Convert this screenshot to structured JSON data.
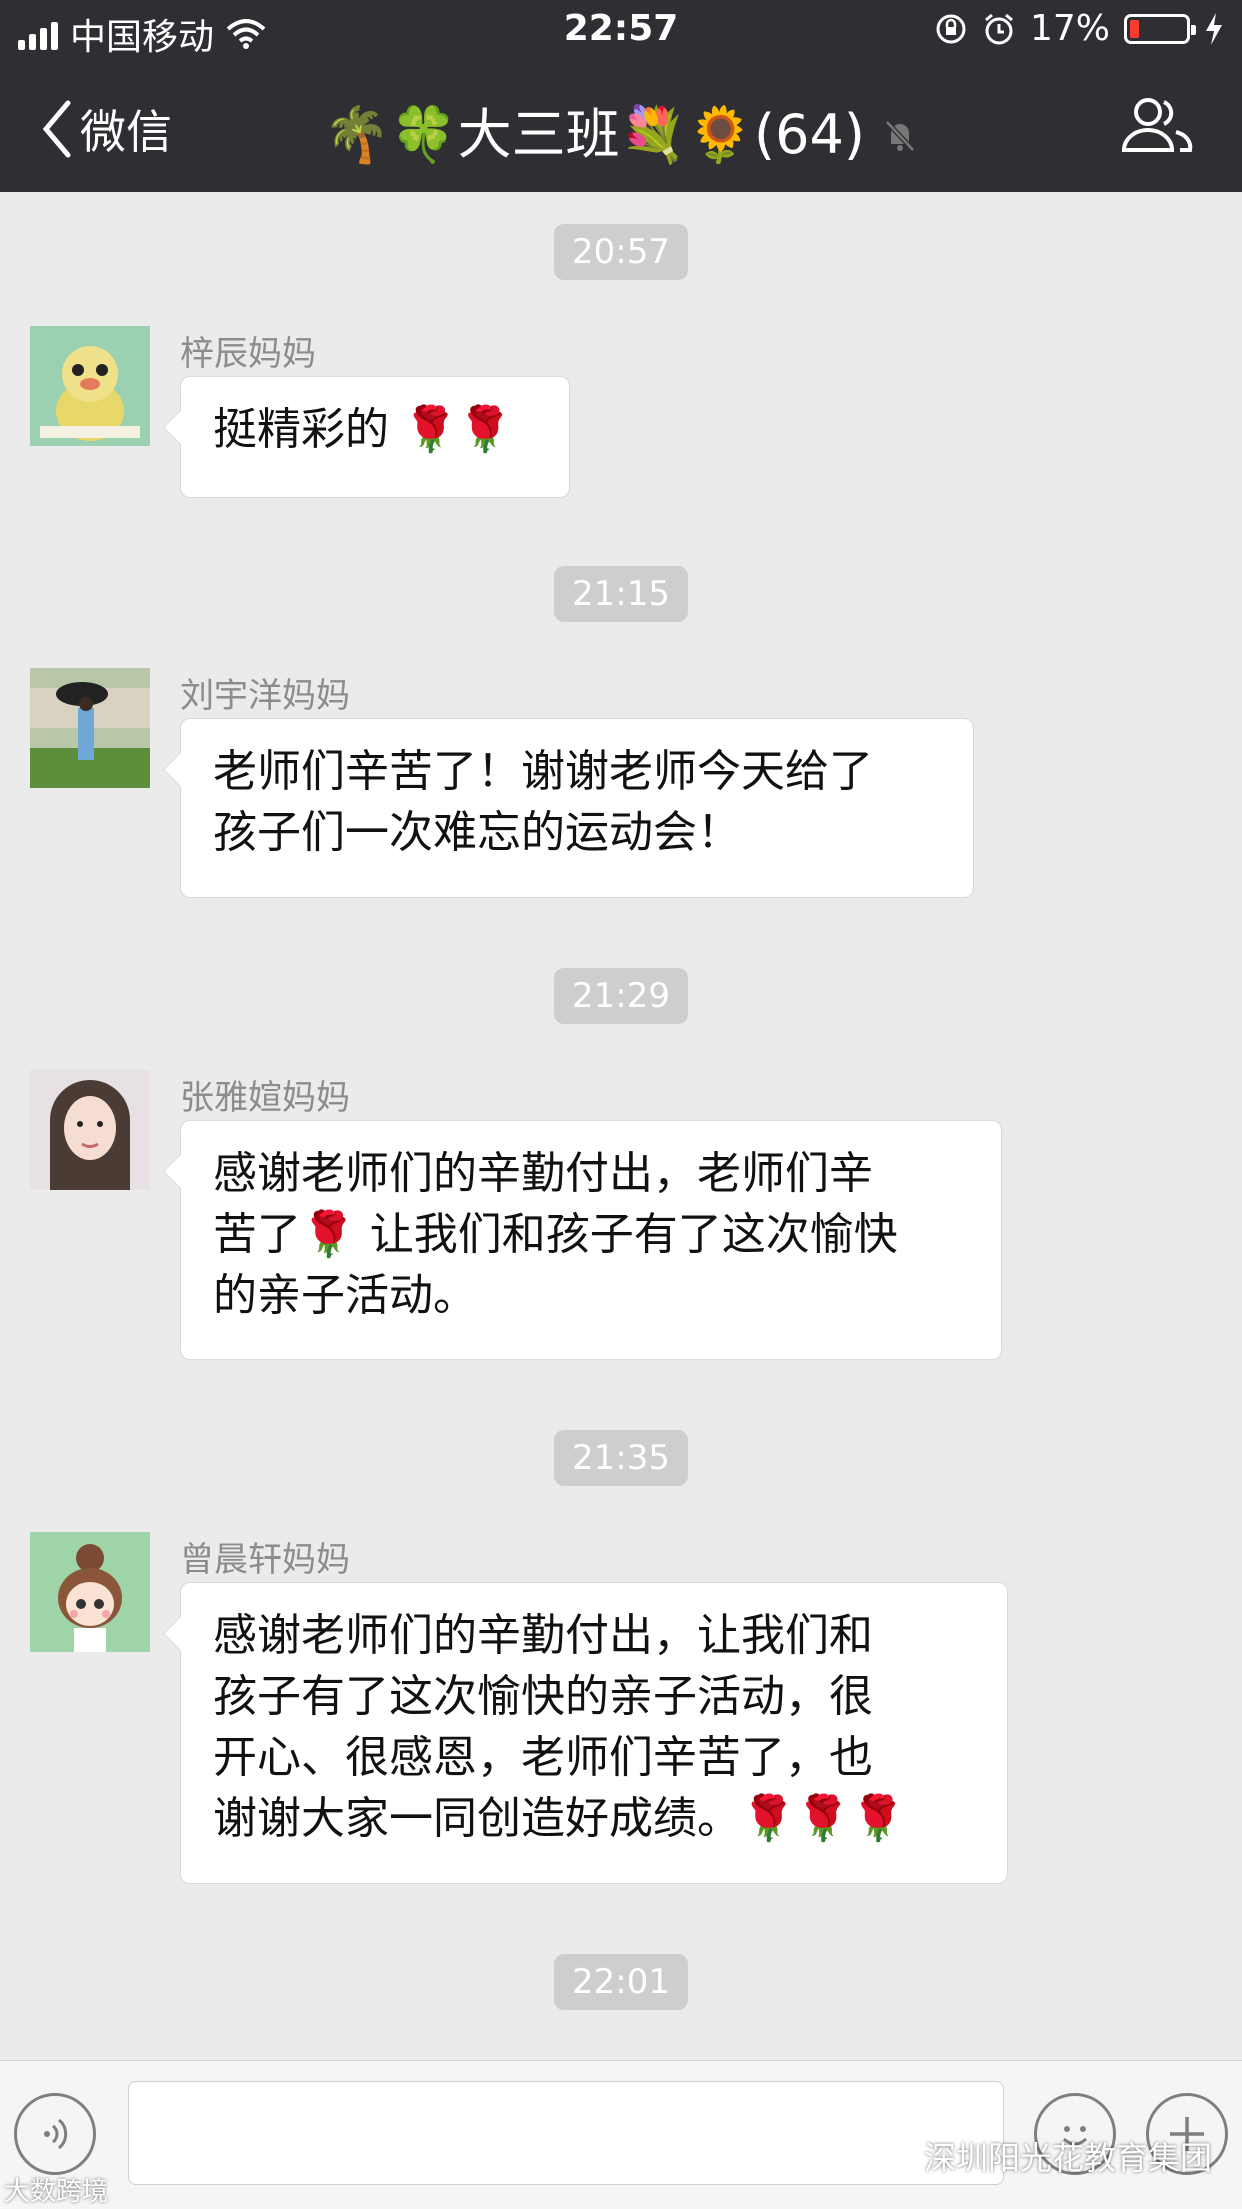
{
  "status_bar": {
    "carrier": "中国移动",
    "time": "22:57",
    "battery": "17%",
    "battery_level": 0.17
  },
  "nav": {
    "back_label": "微信",
    "title": "🌴🍀大三班💐🌻(64)"
  },
  "messages": [
    {
      "time": "20:57",
      "sender": "梓辰妈妈",
      "lines": [
        "挺精彩的 🌹🌹"
      ]
    },
    {
      "time": "21:15",
      "sender": "刘宇洋妈妈",
      "lines": [
        "老师们辛苦了！谢谢老师今天给了",
        "孩子们一次难忘的运动会！"
      ]
    },
    {
      "time": "21:29",
      "sender": "张雅媗妈妈",
      "lines": [
        "感谢老师们的辛勤付出，老师们辛",
        "苦了🌹 让我们和孩子有了这次愉快",
        "的亲子活动。"
      ]
    },
    {
      "time": "21:35",
      "sender": "曾晨轩妈妈",
      "lines": [
        " 感谢老师们的辛勤付出，让我们和",
        "孩子有了这次愉快的亲子活动，很",
        "开心、很感恩，老师们辛苦了，也",
        "谢谢大家一同创造好成绩。🌹🌹🌹"
      ]
    },
    {
      "time": "22:01"
    }
  ],
  "input": {
    "value": ""
  },
  "watermarks": {
    "right": "深圳阳光花教育集团",
    "left": "大数跨境"
  },
  "icons": {
    "back": "chevron-left-icon",
    "mute": "bell-slash-icon",
    "members": "group-icon",
    "voice": "voice-icon",
    "emoji": "emoji-icon",
    "plus": "plus-icon",
    "wifi": "wifi-icon",
    "lock": "orientation-lock-icon",
    "alarm": "alarm-icon",
    "charging": "charging-icon"
  }
}
